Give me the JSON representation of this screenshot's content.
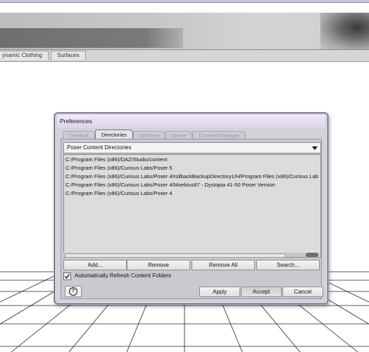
{
  "app": {
    "tabs": [
      {
        "label": "ynamic Clothing"
      },
      {
        "label": "Surfaces"
      }
    ]
  },
  "dialog": {
    "title": "Preferences",
    "tabs": [
      {
        "label": "General",
        "active": false
      },
      {
        "label": "Directories",
        "active": true
      },
      {
        "label": "Interface",
        "active": false
      },
      {
        "label": "Scene",
        "active": false
      },
      {
        "label": "Content Manager",
        "active": false
      }
    ],
    "content_type": {
      "selected": "Poser Content Directories"
    },
    "directories": [
      "C:/Program Files (x86)/DAZ/Studio/content",
      "C:/Program Files (x86)/Curious Labs/Poser 5",
      "C:/Program Files (x86)/Curious Labs/Poser 4/rollbackBackupDirectory1/H/Program Files (x86)/Curious Lab",
      "C:/Program Files (x86)/Curious Labs/Poser 4/Moebius87 - Dystopia 41-50 Poser Version",
      "C:/Program Files (x86)/Curious Labs/Poser 4"
    ],
    "buttons": {
      "add": "Add...",
      "remove": "Remove",
      "remove_all": "Remove All",
      "search": "Search...",
      "apply": "Apply",
      "accept": "Accept",
      "cancel": "Cancel",
      "help_glyph": "?"
    },
    "auto_refresh": {
      "label": "Automatically Refresh Content Folders",
      "checked": true
    }
  },
  "colors": {
    "dialog_border": "#5c556b",
    "title_gradient_start": "#efeaf6",
    "panel_bg": "#cbc8d0"
  },
  "icons": [
    "dropdown-arrow-icon",
    "help-icon",
    "checkmark-icon"
  ]
}
